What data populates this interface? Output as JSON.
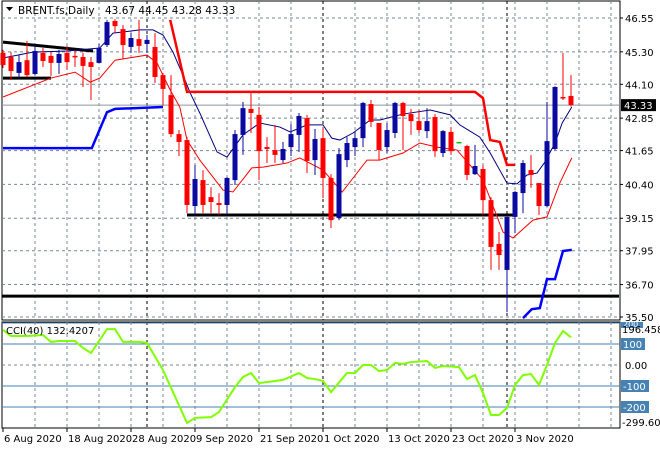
{
  "header": {
    "symbol_timeframe": "BRENT.fs,Daily",
    "ohlc_readout": "43.67 44.45 43.28 43.33"
  },
  "colors": {
    "bull": "#0a0aa0",
    "bear": "#ff0000",
    "doji": "#00c000",
    "ma": "#000080",
    "band_lower": "#ff0000",
    "stop_upper": "#ff0000",
    "stop_lower": "#0000ff",
    "cci_line": "#7fff00",
    "cci_level": "#4682b4",
    "grid": "#778899"
  },
  "chart_data": [
    {
      "type": "candlestick",
      "title": "BRENT.fs,Daily",
      "x_unit": "bar index (daily)",
      "ylim": [
        35.5,
        46.55
      ],
      "y_ticks": [
        "46.55",
        "45.30",
        "44.10",
        "42.85",
        "41.65",
        "40.40",
        "39.15",
        "37.95",
        "36.70",
        "35.50"
      ],
      "current_price": "43.33",
      "x_tick_labels": [
        {
          "bar": 0,
          "label": "6 Aug 2020"
        },
        {
          "bar": 8,
          "label": "18 Aug 2020"
        },
        {
          "bar": 16,
          "label": "28 Aug 2020"
        },
        {
          "bar": 24,
          "label": "9 Sep 2020"
        },
        {
          "bar": 32,
          "label": "21 Sep 2020"
        },
        {
          "bar": 40,
          "label": "1 Oct 2020"
        },
        {
          "bar": 48,
          "label": "13 Oct 2020"
        },
        {
          "bar": 56,
          "label": "23 Oct 2020"
        },
        {
          "bar": 64,
          "label": "3 Nov 2020"
        }
      ],
      "period_separators": [
        18,
        40,
        63
      ],
      "candles_ohlc": [
        [
          45.26,
          45.37,
          44.7,
          44.81
        ],
        [
          45.11,
          45.29,
          44.26,
          44.59
        ],
        [
          44.52,
          45.18,
          44.33,
          44.92
        ],
        [
          44.99,
          45.7,
          44.37,
          44.44
        ],
        [
          44.48,
          45.55,
          44.44,
          45.33
        ],
        [
          45.26,
          45.44,
          44.74,
          44.96
        ],
        [
          45.15,
          45.29,
          44.41,
          44.89
        ],
        [
          44.89,
          45.37,
          44.48,
          45.22
        ],
        [
          45.26,
          45.52,
          44.63,
          44.92
        ],
        [
          45.15,
          45.33,
          44.74,
          45.11
        ],
        [
          45.11,
          45.26,
          44.0,
          44.78
        ],
        [
          44.92,
          45.11,
          43.52,
          44.74
        ],
        [
          44.89,
          45.59,
          44.89,
          45.44
        ],
        [
          45.55,
          46.48,
          45.48,
          46.4
        ],
        [
          46.44,
          46.51,
          45.99,
          46.25
        ],
        [
          46.14,
          46.29,
          45.04,
          45.55
        ],
        [
          45.48,
          45.99,
          45.26,
          45.81
        ],
        [
          45.77,
          46.48,
          45.26,
          45.52
        ],
        [
          45.59,
          45.92,
          45.26,
          45.74
        ],
        [
          45.48,
          45.99,
          44.15,
          44.37
        ],
        [
          44.44,
          44.52,
          43.33,
          43.93
        ],
        [
          43.7,
          44.44,
          42.15,
          42.26
        ],
        [
          42.26,
          42.41,
          41.45,
          41.97
        ],
        [
          42.04,
          42.15,
          39.34,
          39.64
        ],
        [
          39.6,
          41.12,
          39.27,
          40.6
        ],
        [
          40.56,
          40.93,
          39.34,
          39.64
        ],
        [
          39.93,
          40.3,
          39.34,
          39.75
        ],
        [
          39.71,
          40.08,
          39.27,
          39.64
        ],
        [
          39.64,
          40.67,
          39.34,
          40.64
        ],
        [
          40.56,
          42.41,
          40.38,
          42.26
        ],
        [
          42.23,
          43.45,
          41.49,
          43.22
        ],
        [
          43.19,
          43.82,
          42.3,
          43.04
        ],
        [
          42.97,
          43.26,
          40.56,
          41.63
        ],
        [
          41.78,
          42.15,
          41.19,
          41.71
        ],
        [
          41.67,
          42.6,
          41.19,
          41.49
        ],
        [
          41.3,
          41.97,
          41.19,
          41.71
        ],
        [
          41.78,
          42.63,
          41.45,
          42.26
        ],
        [
          42.23,
          43.04,
          41.6,
          42.93
        ],
        [
          42.85,
          42.97,
          40.82,
          41.27
        ],
        [
          41.3,
          42.45,
          40.75,
          42.08
        ],
        [
          42.11,
          42.52,
          39.9,
          40.64
        ],
        [
          40.64,
          40.78,
          38.79,
          39.08
        ],
        [
          39.16,
          41.74,
          39.08,
          41.52
        ],
        [
          41.3,
          42.15,
          41.04,
          41.93
        ],
        [
          41.78,
          42.34,
          41.45,
          42.11
        ],
        [
          42.11,
          43.45,
          41.78,
          43.41
        ],
        [
          43.37,
          43.52,
          42.52,
          42.71
        ],
        [
          42.67,
          42.67,
          41.3,
          41.67
        ],
        [
          41.78,
          42.67,
          41.56,
          42.41
        ],
        [
          42.3,
          43.45,
          42.11,
          43.41
        ],
        [
          43.41,
          43.45,
          41.67,
          42.93
        ],
        [
          43.0,
          43.19,
          42.23,
          42.74
        ],
        [
          42.74,
          43.15,
          42.3,
          42.41
        ],
        [
          42.37,
          43.22,
          42.11,
          42.74
        ],
        [
          42.89,
          43.0,
          41.41,
          41.63
        ],
        [
          41.56,
          42.41,
          41.41,
          42.37
        ],
        [
          42.34,
          42.52,
          41.49,
          41.63
        ],
        [
          41.97,
          41.97,
          41.97,
          41.97
        ],
        [
          41.82,
          41.86,
          40.56,
          40.75
        ],
        [
          40.78,
          41.86,
          40.75,
          41.08
        ],
        [
          40.97,
          41.12,
          39.27,
          39.82
        ],
        [
          39.82,
          39.93,
          37.24,
          38.09
        ],
        [
          38.2,
          38.64,
          37.24,
          37.79
        ],
        [
          37.24,
          39.2,
          35.68,
          39.2
        ],
        [
          39.2,
          40.16,
          38.6,
          40.12
        ],
        [
          40.08,
          41.3,
          39.34,
          41.19
        ],
        [
          40.93,
          41.49,
          40.27,
          40.75
        ],
        [
          40.45,
          40.45,
          39.27,
          39.6
        ],
        [
          39.6,
          43.45,
          39.57,
          42.0
        ],
        [
          41.71,
          44.03,
          41.67,
          44.0
        ],
        [
          43.63,
          45.26,
          43.52,
          43.59
        ],
        [
          43.67,
          44.45,
          43.28,
          43.33
        ]
      ],
      "overlays": {
        "moving_average": [
          [
            0,
            45.07
          ],
          [
            3.75,
            45.29
          ],
          [
            8,
            45.33
          ],
          [
            12.1,
            45.44
          ],
          [
            13.75,
            45.99
          ],
          [
            17.1,
            46.11
          ],
          [
            18.75,
            46.11
          ],
          [
            20,
            45.92
          ],
          [
            21.25,
            45.29
          ],
          [
            22.75,
            44.26
          ],
          [
            23.4,
            43.78
          ],
          [
            24.6,
            43.04
          ],
          [
            26.75,
            41.6
          ],
          [
            28,
            41.41
          ],
          [
            30,
            42.23
          ],
          [
            32.1,
            42.67
          ],
          [
            34.6,
            42.52
          ],
          [
            35.9,
            42.34
          ],
          [
            38,
            42.6
          ],
          [
            40,
            42.6
          ],
          [
            41.1,
            42.11
          ],
          [
            42.1,
            42.04
          ],
          [
            43.75,
            42.3
          ],
          [
            45.9,
            42.78
          ],
          [
            47.1,
            42.78
          ],
          [
            50,
            43.0
          ],
          [
            53.4,
            43.15
          ],
          [
            55.9,
            42.97
          ],
          [
            57.1,
            42.6
          ],
          [
            59.6,
            42.15
          ],
          [
            60.9,
            41.56
          ],
          [
            63,
            40.45
          ],
          [
            64.25,
            40.42
          ],
          [
            65.5,
            40.75
          ],
          [
            66.75,
            40.82
          ],
          [
            67.75,
            41.23
          ],
          [
            69,
            41.93
          ],
          [
            69.9,
            42.67
          ],
          [
            71.1,
            43.26
          ]
        ],
        "lower_band": [
          [
            0,
            43.63
          ],
          [
            6,
            44.33
          ],
          [
            9,
            44.55
          ],
          [
            10.9,
            44.18
          ],
          [
            12.1,
            44.33
          ],
          [
            14,
            44.99
          ],
          [
            18,
            45.18
          ],
          [
            19.25,
            44.89
          ],
          [
            20.9,
            43.89
          ],
          [
            22.1,
            43.26
          ],
          [
            23,
            42.04
          ],
          [
            24.6,
            41.3
          ],
          [
            27.5,
            40.19
          ],
          [
            28.75,
            40.12
          ],
          [
            31.1,
            41.01
          ],
          [
            32.5,
            41.04
          ],
          [
            35.5,
            41.19
          ],
          [
            37.1,
            41.38
          ],
          [
            40,
            40.93
          ],
          [
            42.4,
            40.12
          ],
          [
            45.5,
            41.3
          ],
          [
            47.1,
            41.3
          ],
          [
            50,
            41.56
          ],
          [
            52.1,
            41.93
          ],
          [
            54.25,
            41.78
          ],
          [
            56.75,
            41.67
          ],
          [
            60,
            40.56
          ],
          [
            62.5,
            38.64
          ],
          [
            63.75,
            38.42
          ],
          [
            66.25,
            39.08
          ],
          [
            68,
            39.2
          ],
          [
            69.6,
            40.45
          ],
          [
            71.1,
            41.38
          ]
        ],
        "upper_stop": [
          [
            20.9,
            46.48
          ],
          [
            23,
            43.82
          ],
          [
            59,
            43.82
          ],
          [
            60,
            43.59
          ],
          [
            60.9,
            42.04
          ],
          [
            62.1,
            41.97
          ],
          [
            63,
            41.12
          ],
          [
            64,
            41.12
          ]
        ],
        "lower_stop_1": [
          [
            0,
            41.74
          ],
          [
            11.1,
            41.74
          ],
          [
            13,
            43.07
          ],
          [
            14,
            43.19
          ],
          [
            20,
            43.26
          ]
        ],
        "lower_stop_2": [
          [
            65,
            35.46
          ],
          [
            66.1,
            35.79
          ],
          [
            67.1,
            35.83
          ],
          [
            68,
            36.9
          ],
          [
            69,
            36.9
          ],
          [
            70,
            37.94
          ],
          [
            71.1,
            37.98
          ]
        ]
      },
      "trendlines": [
        {
          "name": "wedge-top",
          "points": [
            [
              0,
              45.66
            ],
            [
              11.25,
              45.33
            ]
          ]
        },
        {
          "name": "wedge-bottom",
          "points": [
            [
              0,
              44.33
            ],
            [
              6,
              44.33
            ]
          ]
        },
        {
          "name": "support-39",
          "points": [
            [
              23,
              39.27
            ],
            [
              63.75,
              39.27
            ]
          ]
        },
        {
          "name": "support-36",
          "points": [
            [
              -1,
              36.27
            ],
            [
              77,
              36.27
            ]
          ]
        }
      ]
    },
    {
      "type": "line",
      "title": "CCI(40) 132.4207",
      "ylim": [
        -299.603,
        196.4581
      ],
      "y_labels": {
        "max": "196.4581",
        "min": "-299.603",
        "zero": "0.00",
        "hidden_200": "200",
        "levels": [
          "100",
          "-100",
          "-200"
        ]
      },
      "levels": [
        200,
        100,
        -100,
        -200
      ],
      "points": [
        [
          0,
          167
        ],
        [
          1,
          138
        ],
        [
          3,
          138
        ],
        [
          5,
          143
        ],
        [
          6,
          110
        ],
        [
          7,
          114
        ],
        [
          9,
          114
        ],
        [
          10,
          81
        ],
        [
          11,
          57
        ],
        [
          13,
          171
        ],
        [
          14,
          171
        ],
        [
          15,
          110
        ],
        [
          17,
          110
        ],
        [
          18,
          105
        ],
        [
          20,
          -24
        ],
        [
          23,
          -276
        ],
        [
          24,
          -252
        ],
        [
          26,
          -248
        ],
        [
          27,
          -224
        ],
        [
          29,
          -105
        ],
        [
          30,
          -57
        ],
        [
          31,
          -38
        ],
        [
          32,
          -86
        ],
        [
          34,
          -76
        ],
        [
          35,
          -71
        ],
        [
          37,
          -38
        ],
        [
          38,
          -62
        ],
        [
          39,
          -67
        ],
        [
          40,
          -76
        ],
        [
          41,
          -129
        ],
        [
          43,
          -38
        ],
        [
          44,
          -38
        ],
        [
          45,
          0
        ],
        [
          46,
          0
        ],
        [
          47,
          -29
        ],
        [
          48,
          -24
        ],
        [
          49,
          10
        ],
        [
          50,
          5
        ],
        [
          51,
          14
        ],
        [
          53,
          19
        ],
        [
          54,
          -14
        ],
        [
          55,
          -5
        ],
        [
          57,
          -10
        ],
        [
          58,
          -67
        ],
        [
          59,
          -48
        ],
        [
          60,
          -133
        ],
        [
          61,
          -238
        ],
        [
          62,
          -238
        ],
        [
          63,
          -205
        ],
        [
          64,
          -95
        ],
        [
          65,
          -48
        ],
        [
          66,
          -43
        ],
        [
          67,
          -95
        ],
        [
          68,
          0
        ],
        [
          69,
          105
        ],
        [
          70,
          162
        ],
        [
          71,
          132
        ]
      ]
    }
  ]
}
